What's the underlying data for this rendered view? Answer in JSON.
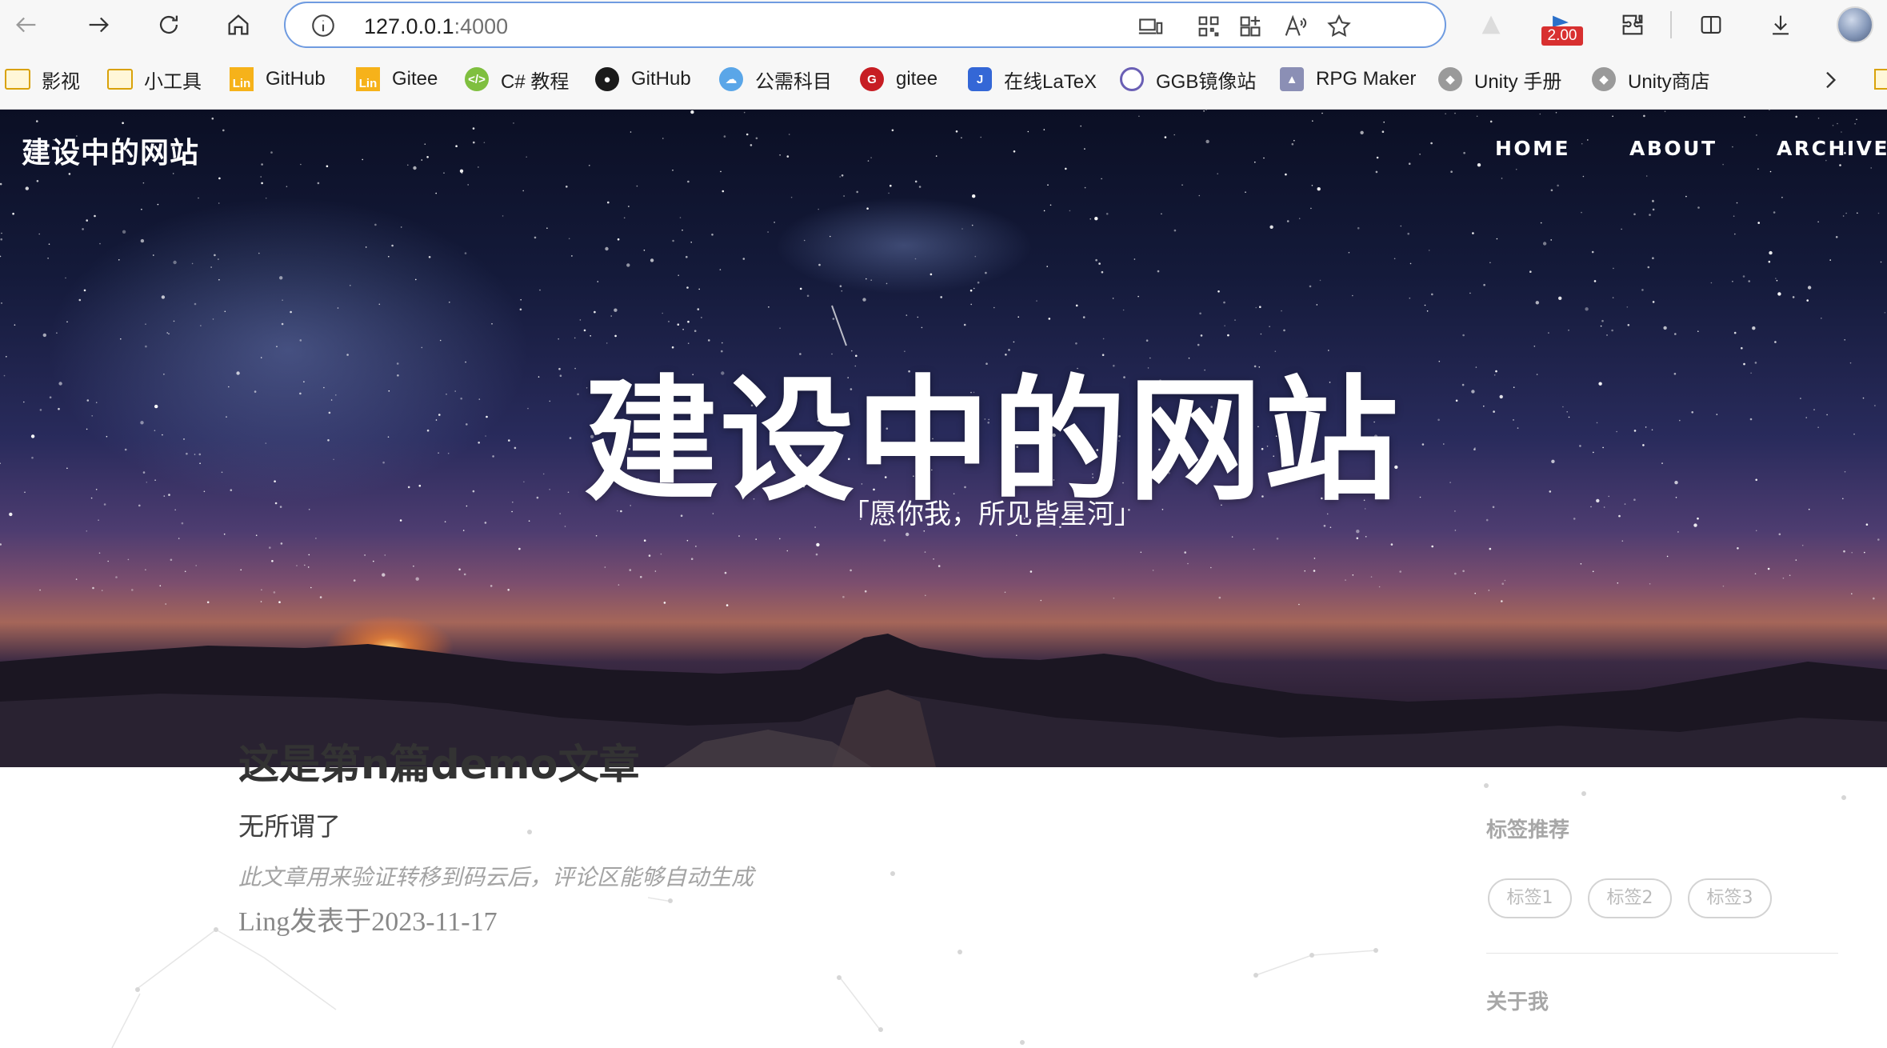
{
  "browser": {
    "url_host": "127.0.0.1",
    "url_port": ":4000",
    "extension_badge": "2.00"
  },
  "bookmarks": [
    {
      "label": "影视",
      "icon": "folder-icon"
    },
    {
      "label": "小工具",
      "icon": "folder-icon"
    },
    {
      "label": "GitHub",
      "icon": "lin-icon"
    },
    {
      "label": "Gitee",
      "icon": "lin-icon"
    },
    {
      "label": "C# 教程",
      "icon": "code-icon"
    },
    {
      "label": "GitHub",
      "icon": "github-icon"
    },
    {
      "label": "公需科目",
      "icon": "cloud-icon"
    },
    {
      "label": "gitee",
      "icon": "gitee-icon"
    },
    {
      "label": "在线LaTeX",
      "icon": "latex-icon"
    },
    {
      "label": "GGB镜像站",
      "icon": "geogebra-icon"
    },
    {
      "label": "RPG Maker",
      "icon": "rpgmaker-icon"
    },
    {
      "label": "Unity 手册",
      "icon": "unity-icon"
    },
    {
      "label": "Unity商店",
      "icon": "unity-icon"
    }
  ],
  "site": {
    "brand": "建设中的网站",
    "nav": [
      "HOME",
      "ABOUT",
      "ARCHIVE"
    ],
    "hero_title": "建设中的网站",
    "hero_subtitle": "「愿你我，所见皆星河」"
  },
  "post": {
    "title": "这是第n篇demo文章",
    "subtitle": "无所谓了",
    "excerpt": "此文章用来验证转移到码云后，评论区能够自动生成",
    "meta": "Ling发表于2023-11-17"
  },
  "sidebar": {
    "tags_heading": "标签推荐",
    "tags": [
      "标签1",
      "标签2",
      "标签3"
    ],
    "about_heading": "关于我"
  }
}
